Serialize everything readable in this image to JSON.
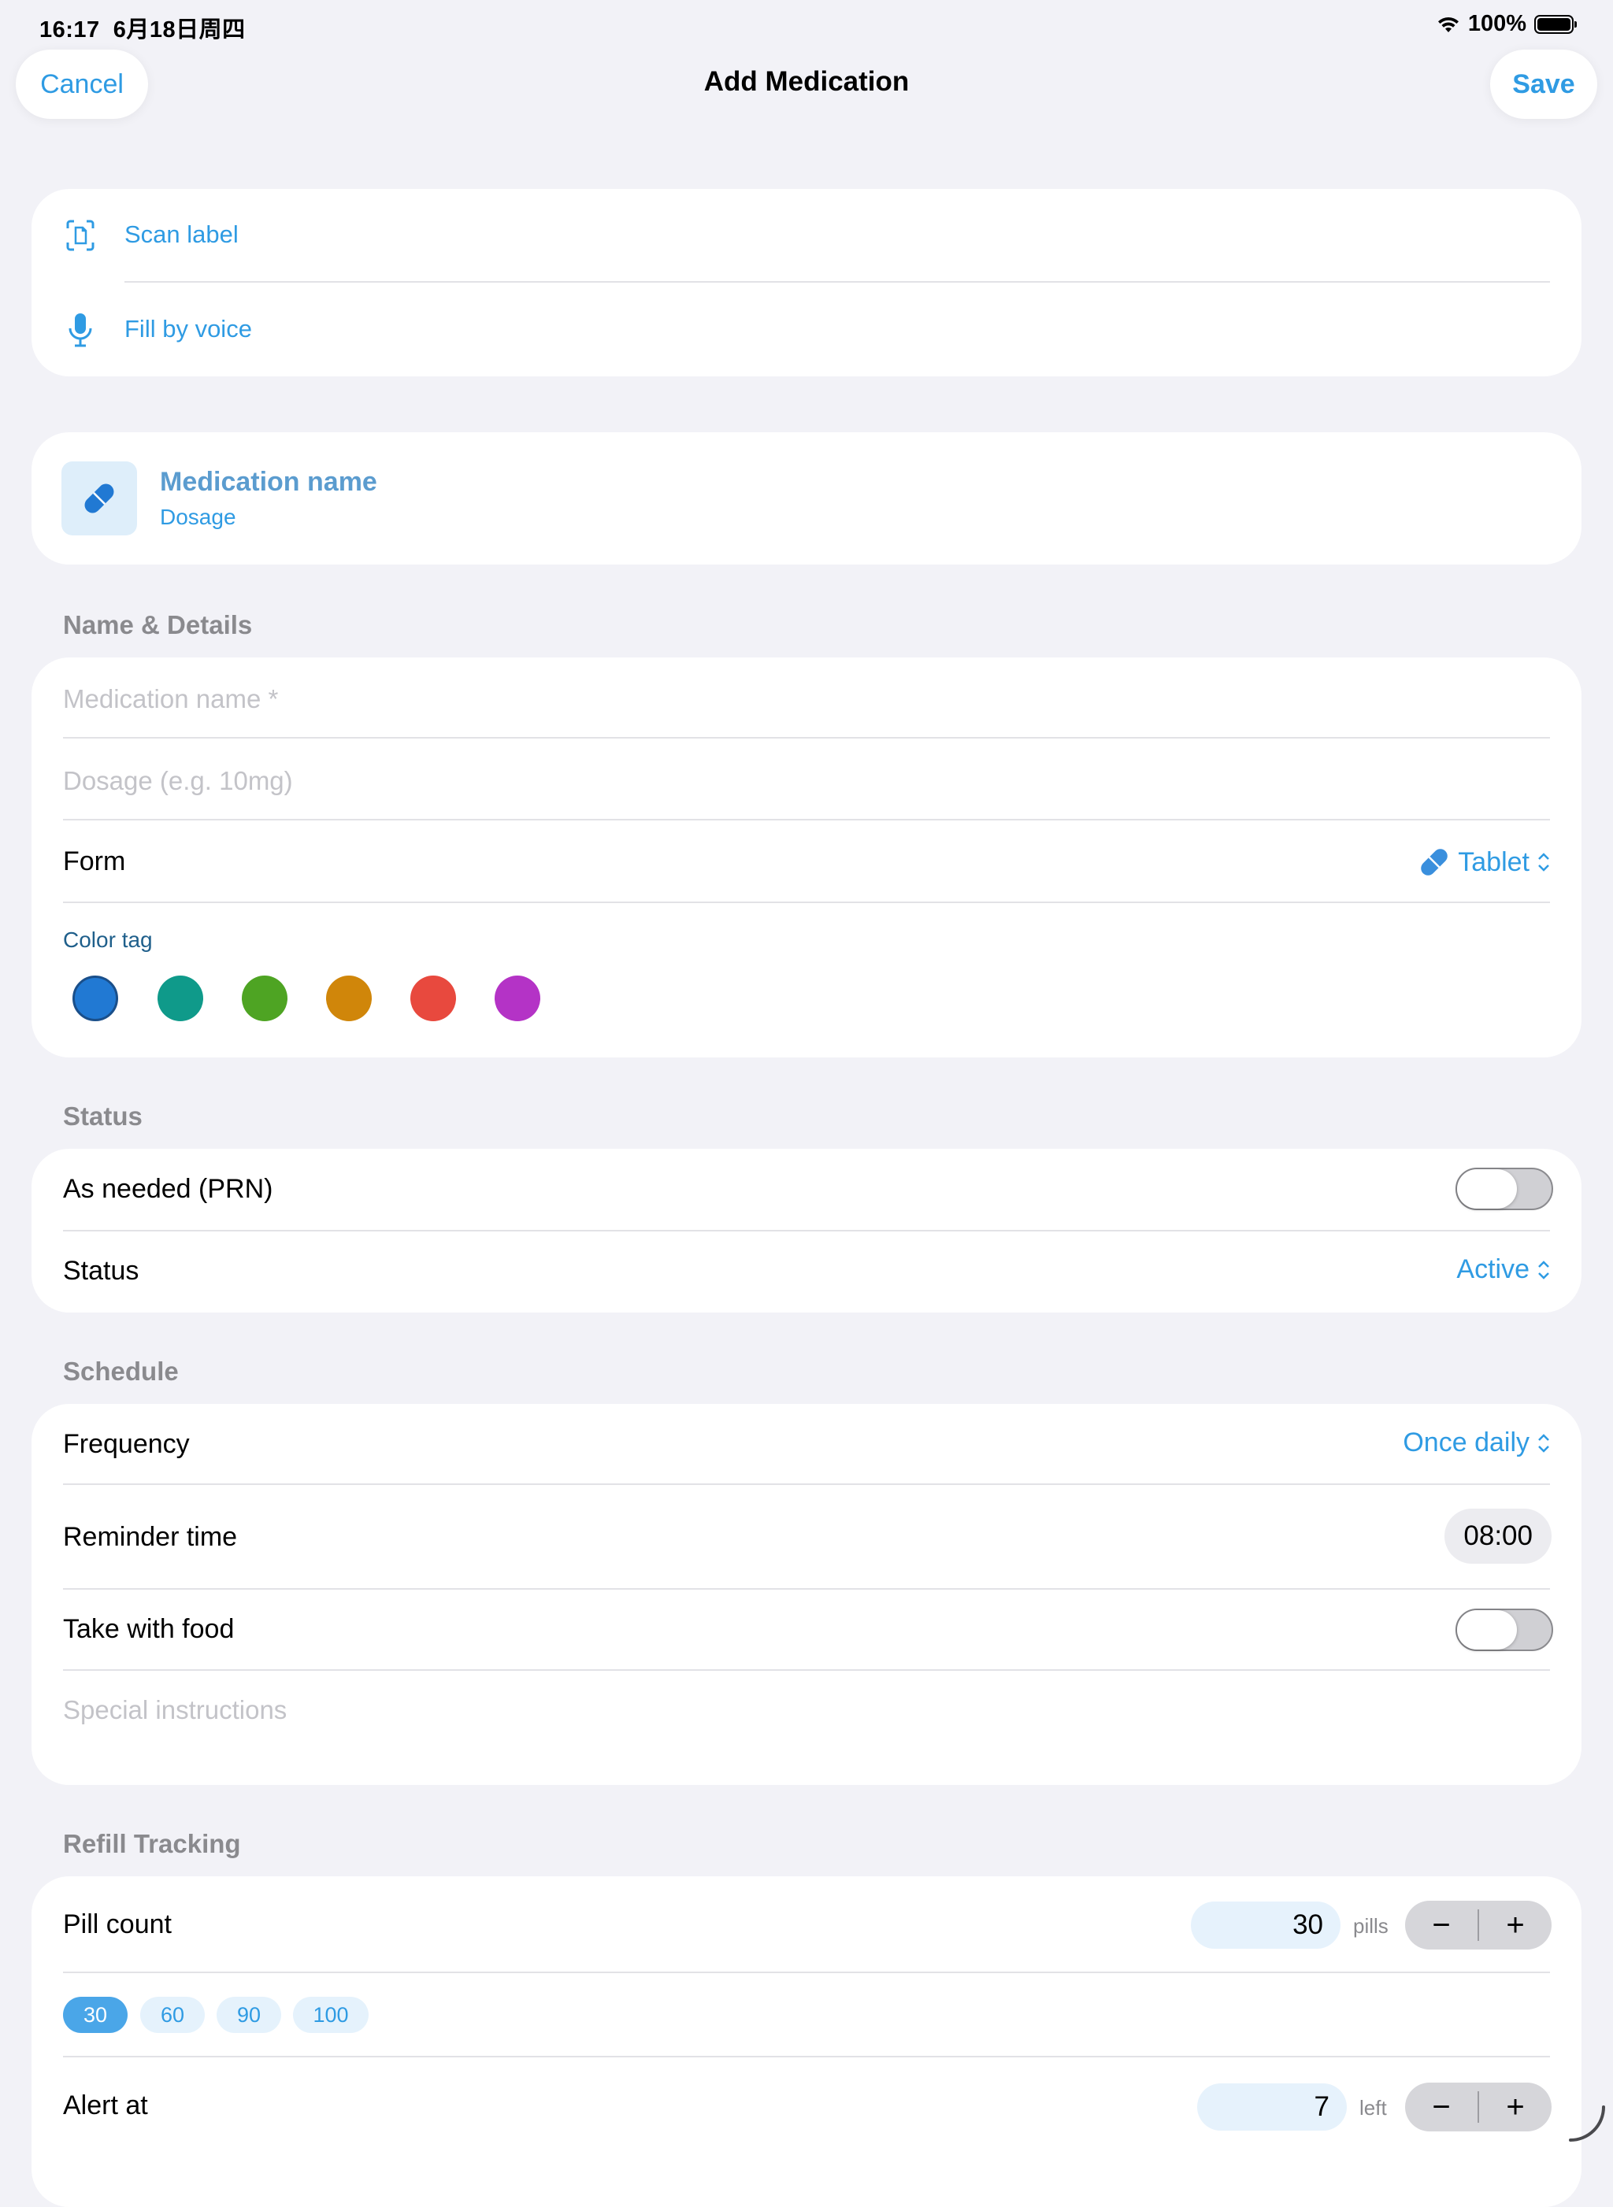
{
  "status_bar": {
    "time": "16:17",
    "date": "6月18日周四",
    "battery": "100%"
  },
  "nav": {
    "cancel": "Cancel",
    "title": "Add Medication",
    "save": "Save"
  },
  "quick_actions": {
    "scan": "Scan label",
    "voice": "Fill by voice"
  },
  "preview": {
    "name": "Medication name",
    "dosage": "Dosage"
  },
  "name_details": {
    "header": "Name & Details",
    "name_placeholder": "Medication name *",
    "dosage_placeholder": "Dosage (e.g. 10mg)",
    "form_label": "Form",
    "form_value": "Tablet",
    "color_tag_label": "Color tag",
    "colors": [
      "#2179d3",
      "#0f9a8a",
      "#4ea423",
      "#d0860a",
      "#e8493e",
      "#b433c6"
    ]
  },
  "status": {
    "header": "Status",
    "prn_label": "As needed (PRN)",
    "prn_on": false,
    "status_label": "Status",
    "status_value": "Active"
  },
  "schedule": {
    "header": "Schedule",
    "frequency_label": "Frequency",
    "frequency_value": "Once daily",
    "reminder_label": "Reminder time",
    "reminder_value": "08:00",
    "food_label": "Take with food",
    "food_on": false,
    "instructions_placeholder": "Special instructions"
  },
  "refill": {
    "header": "Refill Tracking",
    "pill_count_label": "Pill count",
    "pill_count_value": "30",
    "pill_unit": "pills",
    "quick_counts": [
      "30",
      "60",
      "90",
      "100"
    ],
    "selected_count": "30",
    "alert_label": "Alert at",
    "alert_value": "7",
    "alert_unit": "left",
    "minus": "−",
    "plus": "+"
  },
  "colors": {
    "accent": "#2f9be3",
    "background": "#f2f2f7",
    "card": "#ffffff"
  }
}
